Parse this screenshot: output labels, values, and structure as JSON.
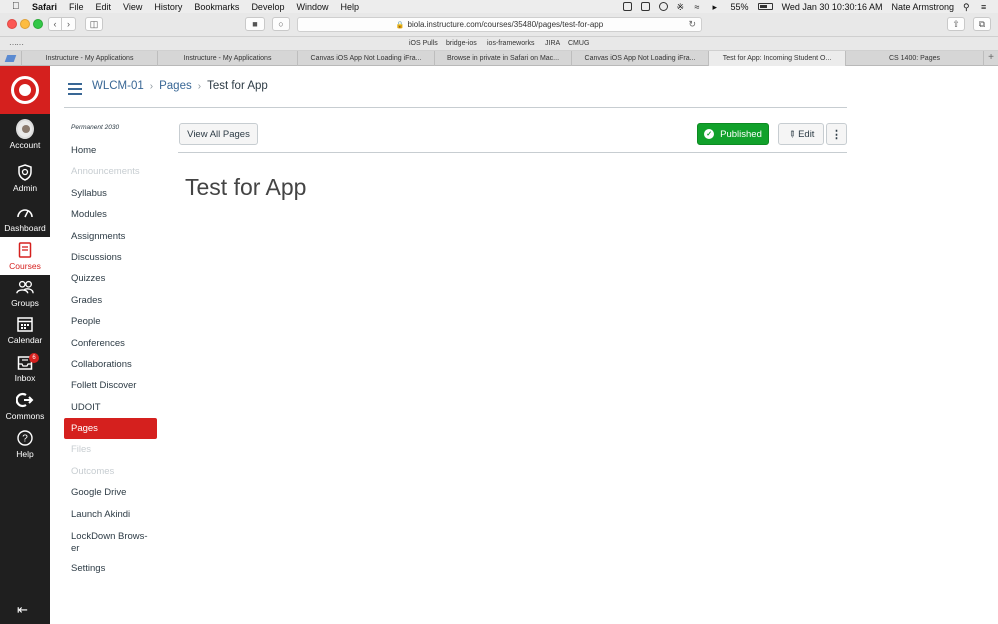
{
  "menubar": {
    "apple": "",
    "items": [
      "Safari",
      "File",
      "Edit",
      "View",
      "History",
      "Bookmarks",
      "Develop",
      "Window",
      "Help"
    ],
    "battery": "55%",
    "datetime": "Wed Jan 30  10:30:16 AM",
    "user": "Nate Armstrong"
  },
  "browser": {
    "url": "biola.instructure.com/courses/35480/pages/test-for-app",
    "favorites": [
      "iOS Pulls",
      "bridge-ios",
      "ios-frameworks",
      "JIRA",
      "CMUG"
    ],
    "tabs": [
      "Instructure - My Applications",
      "Instructure - My Applications",
      "Canvas iOS App Not Loading iFra...",
      "Browse in private in Safari on Mac...",
      "Canvas iOS App Not Loading iFra...",
      "Test for App: Incoming Student O...",
      "CS 1400: Pages"
    ],
    "active_tab_index": 5
  },
  "global_nav": {
    "account": "Account",
    "admin": "Admin",
    "dashboard": "Dashboard",
    "courses": "Courses",
    "groups": "Groups",
    "calendar": "Calendar",
    "inbox": "Inbox",
    "inbox_badge": "6",
    "commons": "Commons",
    "help": "Help"
  },
  "breadcrumb": {
    "course": "WLCM-01",
    "section": "Pages",
    "current": "Test for App"
  },
  "course_nav": {
    "term": "Permanent 2030",
    "items": [
      {
        "label": "Home",
        "state": "normal"
      },
      {
        "label": "Announcements",
        "state": "disabled"
      },
      {
        "label": "Syllabus",
        "state": "normal"
      },
      {
        "label": "Modules",
        "state": "normal"
      },
      {
        "label": "Assignments",
        "state": "normal"
      },
      {
        "label": "Discussions",
        "state": "normal"
      },
      {
        "label": "Quizzes",
        "state": "normal"
      },
      {
        "label": "Grades",
        "state": "normal"
      },
      {
        "label": "People",
        "state": "normal"
      },
      {
        "label": "Conferences",
        "state": "normal"
      },
      {
        "label": "Collaborations",
        "state": "normal"
      },
      {
        "label": "Follett Discover",
        "state": "normal"
      },
      {
        "label": "UDOIT",
        "state": "normal"
      },
      {
        "label": "Pages",
        "state": "active"
      },
      {
        "label": "Files",
        "state": "disabled"
      },
      {
        "label": "Outcomes",
        "state": "disabled"
      },
      {
        "label": "Google Drive",
        "state": "normal"
      },
      {
        "label": "Launch Akindi",
        "state": "normal"
      },
      {
        "label": "LockDown Brows-\ner",
        "state": "normal"
      },
      {
        "label": "Settings",
        "state": "normal"
      }
    ]
  },
  "page": {
    "view_all_label": "View All Pages",
    "published_label": "Published",
    "edit_label": "Edit",
    "more_label": "⋮",
    "title": "Test for App"
  },
  "colors": {
    "brand": "#d5201e",
    "nav_bg": "#1f1f1f",
    "published": "#11a12b",
    "link": "#396795"
  }
}
